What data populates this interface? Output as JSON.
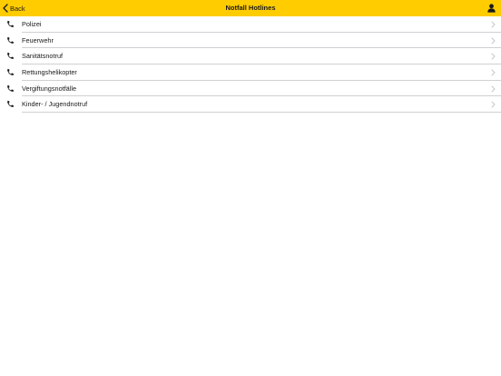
{
  "navbar": {
    "back_label": "Back",
    "title": "Notfall Hotlines",
    "back_icon": "chevron-left-icon",
    "user_icon": "person-icon"
  },
  "list": {
    "items": [
      {
        "label": "Polizei",
        "icon": "phone-icon"
      },
      {
        "label": "Feuerwehr",
        "icon": "phone-icon"
      },
      {
        "label": "Sanitätsnotruf",
        "icon": "phone-icon"
      },
      {
        "label": "Rettungshelikopter",
        "icon": "phone-icon"
      },
      {
        "label": "Vergiftungsnotfälle",
        "icon": "phone-icon"
      },
      {
        "label": "Kinder- / Jugendnotruf",
        "icon": "phone-icon"
      }
    ]
  },
  "colors": {
    "navbar_background": "#ffcc00",
    "text": "#1a1a1a",
    "separator": "#d0d0d4",
    "chevron": "#c7c7cc",
    "background": "#ffffff"
  }
}
